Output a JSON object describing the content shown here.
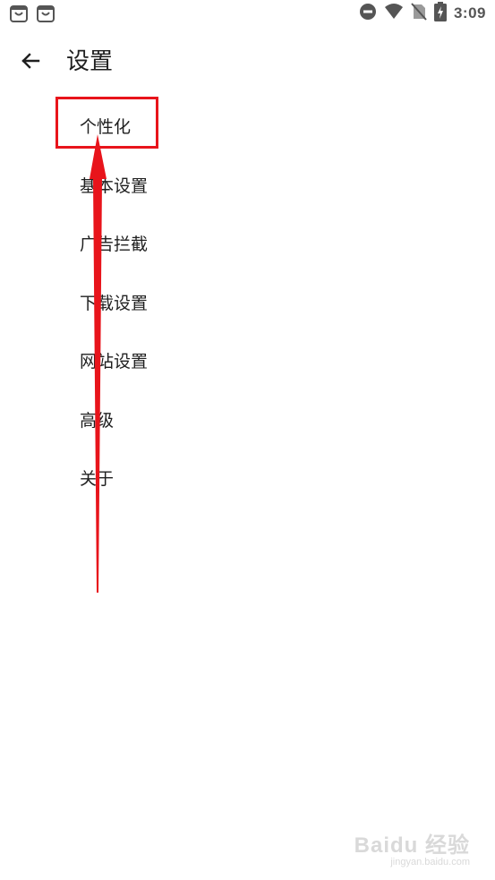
{
  "status_bar": {
    "time": "3:09",
    "left_icons": [
      "shopping-bag-icon",
      "shopping-bag-icon"
    ],
    "right_icons": [
      "do-not-disturb-icon",
      "wifi-icon",
      "no-sim-icon",
      "battery-charging-icon"
    ],
    "icon_color": "#555555"
  },
  "app_bar": {
    "back_icon": "arrow-left-icon",
    "title": "设置"
  },
  "settings": {
    "items": [
      {
        "label": "个性化"
      },
      {
        "label": "基本设置"
      },
      {
        "label": "广告拦截"
      },
      {
        "label": "下载设置"
      },
      {
        "label": "网站设置"
      },
      {
        "label": "高级"
      },
      {
        "label": "关于"
      }
    ]
  },
  "annotation": {
    "color": "#e8141b",
    "highlighted_item": "个性化"
  },
  "watermark": {
    "brand": "Baidu 经验",
    "url": "jingyan.baidu.com"
  }
}
